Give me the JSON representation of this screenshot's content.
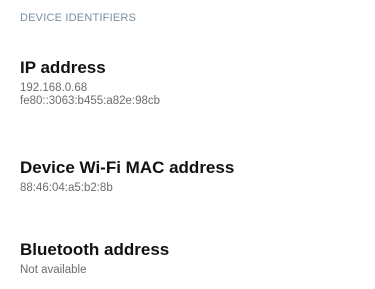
{
  "section": {
    "header": "DEVICE IDENTIFIERS"
  },
  "items": [
    {
      "title": "IP address",
      "values": [
        "192.168.0.68",
        "fe80::3063:b455:a82e:98cb"
      ]
    },
    {
      "title": "Device Wi-Fi MAC address",
      "values": [
        "88:46:04:a5:b2:8b"
      ]
    },
    {
      "title": "Bluetooth address",
      "values": [
        "Not available"
      ]
    }
  ]
}
